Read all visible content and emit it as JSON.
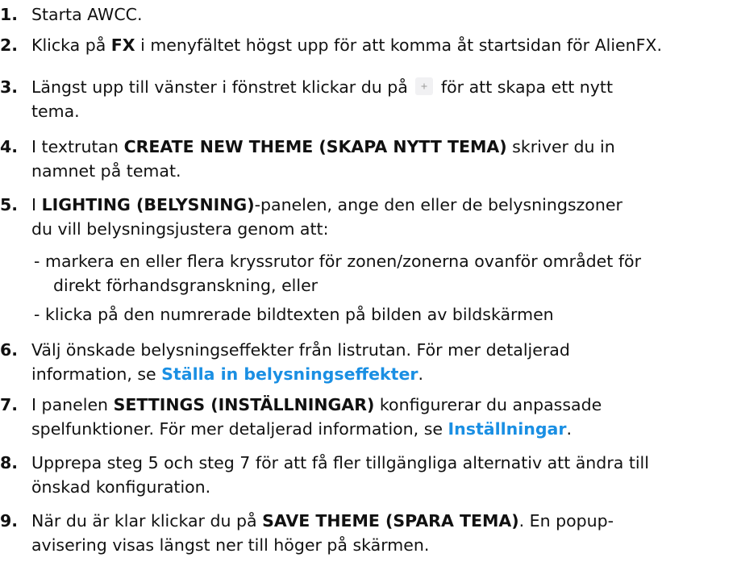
{
  "steps": [
    {
      "num": "1.",
      "parts": {
        "a": "Starta AWCC."
      }
    },
    {
      "num": "2.",
      "parts": {
        "a": "Klicka på ",
        "b": "FX",
        "c": " i menyfältet högst upp för att komma åt startsidan för AlienFX."
      }
    },
    {
      "num": "3.",
      "parts": {
        "a": "Längst upp till vänster i fönstret klickar du på",
        "b": " för att skapa ett nytt",
        "c": "tema."
      },
      "icon": "plus-icon"
    },
    {
      "num": "4.",
      "parts": {
        "a": "I textrutan ",
        "b": "CREATE NEW THEME (SKAPA NYTT TEMA)",
        "c": " skriver du in",
        "d": "namnet på temat."
      }
    },
    {
      "num": "5.",
      "parts": {
        "a": "I ",
        "b": "LIGHTING (BELYSNING)",
        "c": "-panelen, ange den eller de belysningszoner",
        "d": "du vill belysningsjustera genom att:"
      },
      "bullets": [
        {
          "dash": "-",
          "line1": "markera en eller flera kryssrutor för zonen/zonerna ovanför området för",
          "line2": "direkt förhandsgranskning, eller"
        },
        {
          "dash": "-",
          "line1": "klicka på den numrerade bildtexten på bilden av bildskärmen"
        }
      ]
    },
    {
      "num": "6.",
      "parts": {
        "a": "Välj önskade belysningseffekter från listrutan. För mer detaljerad",
        "b": "information, se ",
        "link": "Ställa in belysningseffekter",
        "c": "."
      }
    },
    {
      "num": "7.",
      "parts": {
        "a": "I panelen ",
        "b": "SETTINGS (INSTÄLLNINGAR)",
        "c": " konfigurerar du anpassade",
        "d": "spelfunktioner. För mer detaljerad information, se ",
        "link": "Inställningar",
        "e": "."
      }
    },
    {
      "num": "8.",
      "parts": {
        "a": "Upprepa steg 5 och steg 7 för att få fler tillgängliga alternativ att ändra till",
        "b": "önskad konfiguration."
      }
    },
    {
      "num": "9.",
      "parts": {
        "a": "När du är klar klickar du på ",
        "b": "SAVE THEME (SPARA TEMA)",
        "c": ". En popup-",
        "d": "avisering visas längst ner till höger på skärmen."
      }
    }
  ],
  "colors": {
    "text": "#111111",
    "link": "#1a8fe3",
    "background": "#ffffff"
  }
}
